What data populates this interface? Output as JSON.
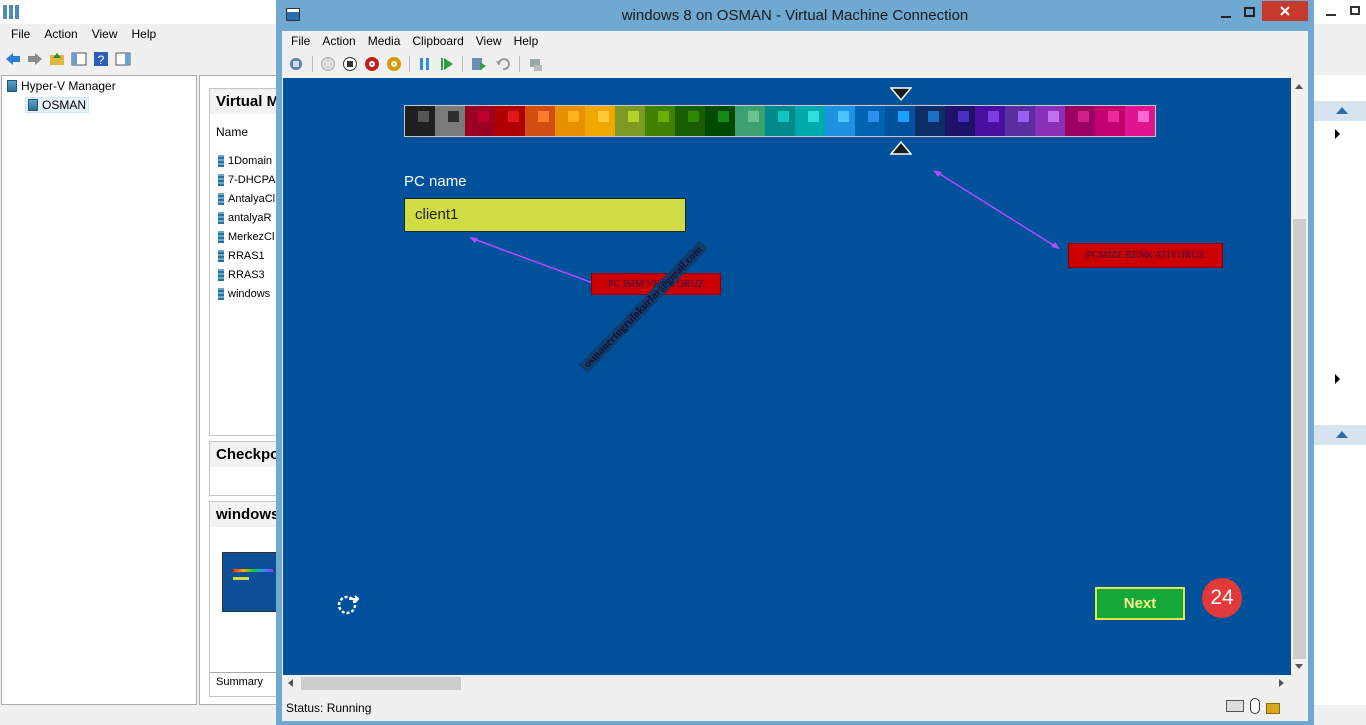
{
  "manager": {
    "menu": [
      "File",
      "Action",
      "View",
      "Help"
    ],
    "tree_root": "Hyper-V Manager",
    "tree_server": "OSMAN",
    "vm_panel_title": "Virtual M",
    "vm_column": "Name",
    "vms": [
      "1Domain",
      "7-DHCPA",
      "AntalyaCl",
      "antalyaR",
      "MerkezCl",
      "RRAS1",
      "RRAS3",
      "windows"
    ],
    "checkpoint_title": "Checkpo",
    "details_title": "windows",
    "summary_tab": "Summary"
  },
  "vm": {
    "title": "windows 8 on OSMAN - Virtual Machine Connection",
    "menu": [
      "File",
      "Action",
      "Media",
      "Clipboard",
      "View",
      "Help"
    ],
    "status": "Status: Running"
  },
  "guest": {
    "palette": [
      {
        "bg": "#1f1f1f",
        "dot": "#555555"
      },
      {
        "bg": "#7a7a7a",
        "dot": "#2e2e2e"
      },
      {
        "bg": "#9b0022",
        "dot": "#c00030"
      },
      {
        "bg": "#b10000",
        "dot": "#e21a1a"
      },
      {
        "bg": "#d24d10",
        "dot": "#ff7a2a"
      },
      {
        "bg": "#e88f00",
        "dot": "#ffb21a"
      },
      {
        "bg": "#f0a800",
        "dot": "#ffca3a"
      },
      {
        "bg": "#7f9a24",
        "dot": "#b3d22a"
      },
      {
        "bg": "#3e8200",
        "dot": "#68b000"
      },
      {
        "bg": "#1a5c00",
        "dot": "#2d8a00"
      },
      {
        "bg": "#004a00",
        "dot": "#138a13"
      },
      {
        "bg": "#3da070",
        "dot": "#6cc390"
      },
      {
        "bg": "#008a8a",
        "dot": "#14c3c3"
      },
      {
        "bg": "#00aaaa",
        "dot": "#30dede"
      },
      {
        "bg": "#1e92e0",
        "dot": "#4cc2ff"
      },
      {
        "bg": "#0063b1",
        "dot": "#2d8ff0"
      },
      {
        "bg": "#00519b",
        "dot": "#19a0ff"
      },
      {
        "bg": "#0b2e66",
        "dot": "#1b6fc7"
      },
      {
        "bg": "#1d1168",
        "dot": "#4b2fc2"
      },
      {
        "bg": "#4a0fa0",
        "dot": "#7b3fe0"
      },
      {
        "bg": "#5b2ea0",
        "dot": "#9a5ff0"
      },
      {
        "bg": "#8a2fb8",
        "dot": "#c070f0"
      },
      {
        "bg": "#9c0060",
        "dot": "#cc2288"
      },
      {
        "bg": "#c2006e",
        "dot": "#f02a9a"
      },
      {
        "bg": "#e01490",
        "dot": "#ff6ad0"
      }
    ],
    "pc_label": "PC name",
    "pc_value": "client1",
    "callout_name": "PC İSİM VERİYORUZ",
    "callout_color": "PCMİZE RENK ATIYORUZ",
    "watermark": "osmanertugrulokurlar@gmail.com",
    "next_label": "Next",
    "step_number": "24",
    "arrow_color": "#b44aff"
  }
}
